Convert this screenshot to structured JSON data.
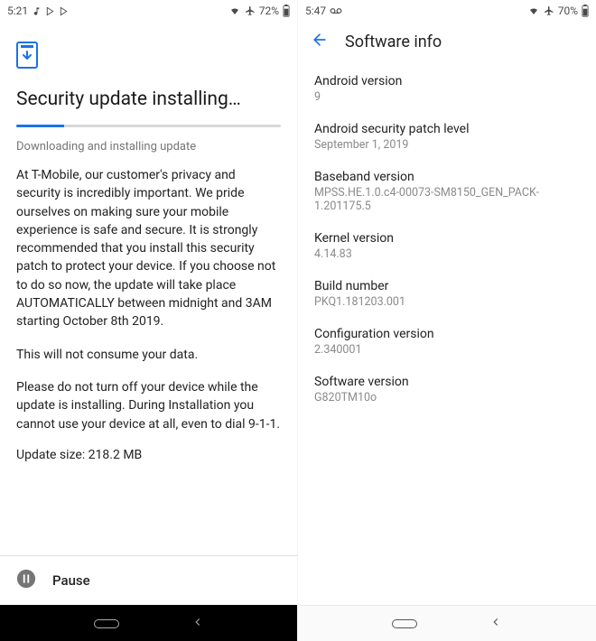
{
  "left": {
    "status": {
      "time": "5:21",
      "battery": "72%"
    },
    "heading": "Security update installing…",
    "status_line": "Downloading and installing update",
    "progress_pct": 18,
    "para1": "At T-Mobile, our customer's privacy and security is incredibly important. We pride ourselves on making sure your mobile experience is safe and secure. It is strongly recommended that you install this security patch to protect your device. If you choose not to do so now, the update will take place AUTOMATICALLY between midnight and 3AM starting October 8th 2019.",
    "para2": "This will not consume your data.",
    "para3": "Please do not turn off your device while the update is installing. During Installation you cannot use your device at all, even to dial 9-1-1.",
    "update_size": "Update size: 218.2 MB",
    "pause_label": "Pause"
  },
  "right": {
    "status": {
      "time": "5:47",
      "battery": "70%"
    },
    "appbar_title": "Software info",
    "items": [
      {
        "label": "Android version",
        "value": "9"
      },
      {
        "label": "Android security patch level",
        "value": "September 1, 2019"
      },
      {
        "label": "Baseband version",
        "value": "MPSS.HE.1.0.c4-00073-SM8150_GEN_PACK-1.201175.5"
      },
      {
        "label": "Kernel version",
        "value": "4.14.83"
      },
      {
        "label": "Build number",
        "value": "PKQ1.181203.001"
      },
      {
        "label": "Configuration version",
        "value": "2.340001"
      },
      {
        "label": "Software version",
        "value": "G820TM10o"
      }
    ]
  }
}
